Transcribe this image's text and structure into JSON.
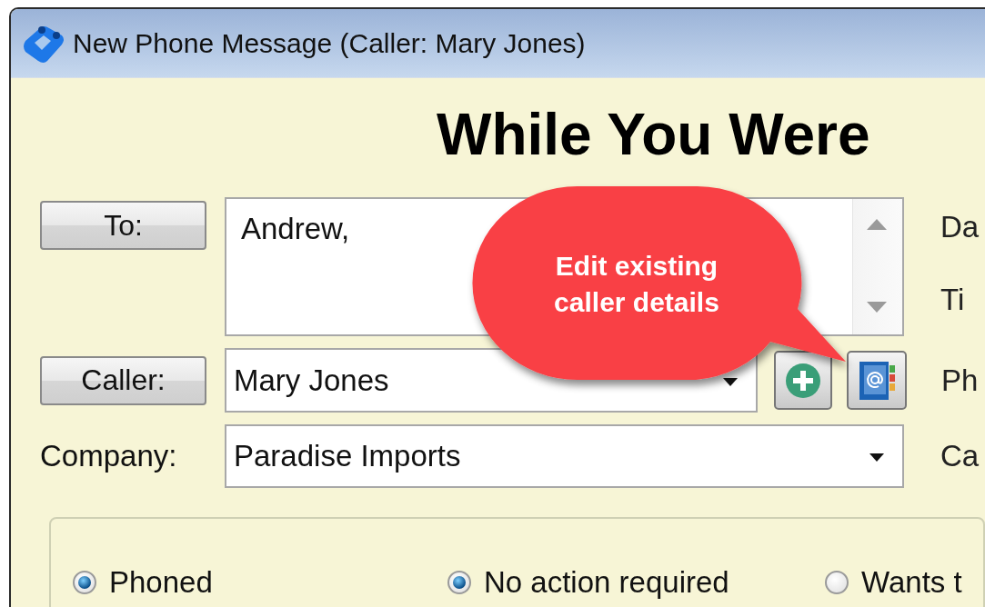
{
  "window": {
    "title": "New Phone Message (Caller: Mary Jones)"
  },
  "heading": "While You Were",
  "form": {
    "to_button": "To:",
    "to_value": "Andrew,",
    "caller_button": "Caller:",
    "caller_value": "Mary Jones",
    "company_label": "Company:",
    "company_value": "Paradise Imports"
  },
  "side_labels": [
    "Da",
    "Ti",
    "Ph",
    "Ca"
  ],
  "callout": "Edit existing caller details",
  "radios": [
    {
      "label": "Phoned",
      "checked": true
    },
    {
      "label": "No action required",
      "checked": true
    },
    {
      "label": "Wants t",
      "checked": false
    }
  ]
}
